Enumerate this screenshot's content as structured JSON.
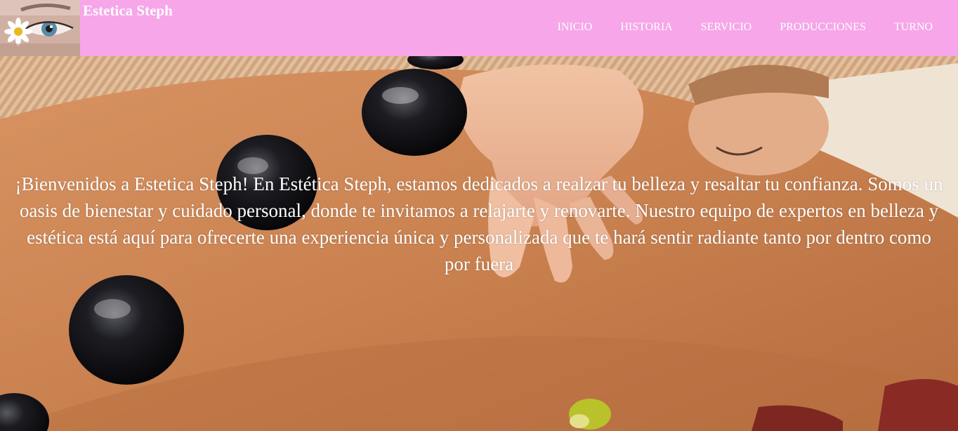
{
  "header": {
    "site_title": "Estetica Steph",
    "background_color": "#f6a6e9",
    "logo_icon": "eye-daisy-logo"
  },
  "nav": {
    "items": [
      {
        "label": "INICIO"
      },
      {
        "label": "HISTORIA"
      },
      {
        "label": "SERVICIO"
      },
      {
        "label": "PRODUCCIONES"
      },
      {
        "label": "TURNO"
      }
    ]
  },
  "hero": {
    "image_icon": "hot-stone-massage-image",
    "welcome_text": "¡Bienvenidos a Estetica Steph! En Estética Steph, estamos dedicados a realzar tu belleza y resaltar tu confianza. Somos un oasis de bienestar y cuidado personal, donde te invitamos a relajarte y renovarte. Nuestro equipo de expertos en belleza y estética está aquí para ofrecerte una experiencia única y personalizada que te hará sentir radiante tanto por dentro como por fuera"
  }
}
